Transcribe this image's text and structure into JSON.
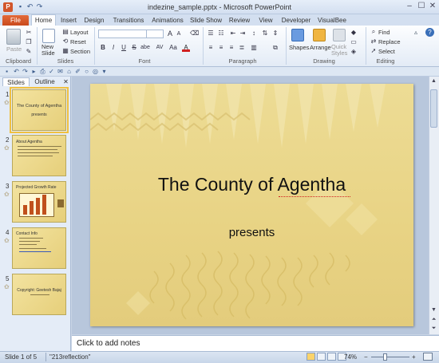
{
  "window": {
    "app_icon_letter": "P",
    "title": "indezine_sample.pptx  -  Microsoft PowerPoint",
    "minimize": "–",
    "maximize": "☐",
    "close": "✕"
  },
  "tabs": [
    "File",
    "Home",
    "Insert",
    "Design",
    "Transitions",
    "Animations",
    "Slide Show",
    "Review",
    "View",
    "Developer",
    "VisualBee"
  ],
  "ribbon": {
    "clipboard": {
      "paste": "Paste",
      "label": "Clipboard"
    },
    "slides": {
      "new_slide": "New Slide",
      "layout": "Layout",
      "reset": "Reset",
      "section": "Section",
      "label": "Slides"
    },
    "font": {
      "label": "Font",
      "font_name": "",
      "font_size": "",
      "bold": "B",
      "italic": "I",
      "underline": "U",
      "strike": "S",
      "shadow": "abe",
      "spacing": "AV",
      "case": "Aa",
      "grow": "A",
      "shrink": "A"
    },
    "paragraph": {
      "label": "Paragraph"
    },
    "drawing": {
      "shapes": "Shapes",
      "arrange": "Arrange",
      "quick_styles": "Quick Styles",
      "label": "Drawing"
    },
    "editing": {
      "find": "Find",
      "replace": "Replace",
      "select": "Select",
      "label": "Editing"
    }
  },
  "panel": {
    "tabs": [
      "Slides",
      "Outline"
    ],
    "close": "✕",
    "thumbnails": [
      {
        "num": "1",
        "title": "The County of Agentha",
        "sub": "presents"
      },
      {
        "num": "2",
        "title": "About Agentha",
        "sub": ""
      },
      {
        "num": "3",
        "title": "Projected Growth  Rate",
        "sub": ""
      },
      {
        "num": "4",
        "title": "Contact Info",
        "sub": ""
      },
      {
        "num": "5",
        "title": "Copyright: Geetesh Bajaj",
        "sub": ""
      }
    ]
  },
  "slide": {
    "title": "The County of Agentha",
    "subtitle": "presents"
  },
  "notes": {
    "placeholder": "Click to add notes"
  },
  "status": {
    "slide_info": "Slide 1 of 5",
    "theme": "\"213reflection\"",
    "zoom": "74%",
    "zoom_minus": "−",
    "zoom_plus": "+"
  },
  "colors": {
    "file_tab": "#d2562b",
    "slide_bg": "#e8d384"
  }
}
